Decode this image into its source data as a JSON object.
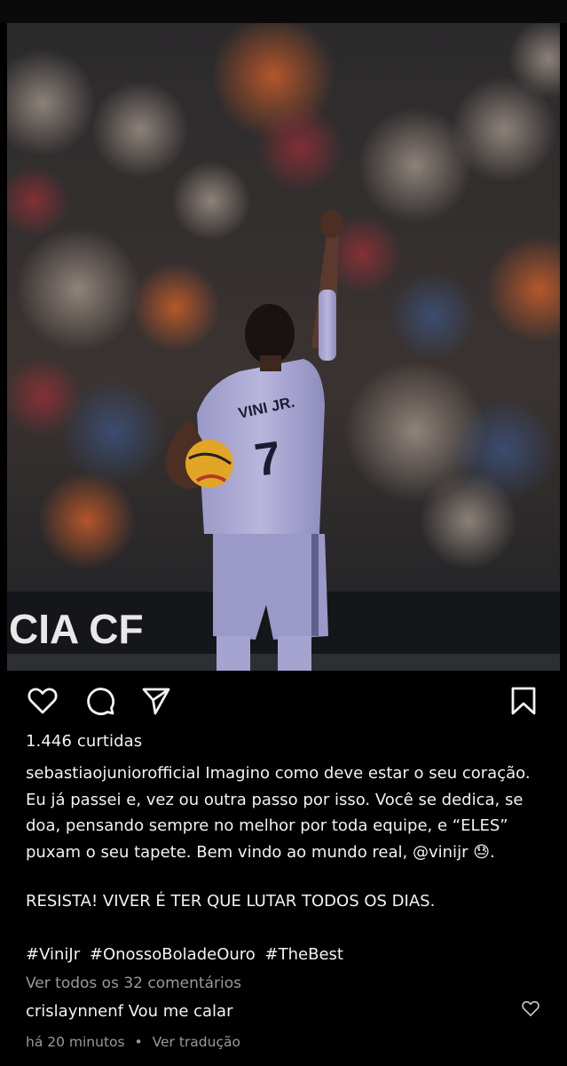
{
  "post": {
    "likes_text": "1.446 curtidas",
    "author": "sebastiaojuniorofficial",
    "caption_text": "Imagino como deve estar o seu coração. Eu já passei e, vez ou outra passo por isso. Você se dedica, se doa, pensando sempre no melhor por toda equipe, e “ELES” puxam o seu tapete. Bem vindo ao mundo real,",
    "mention": "@vinijr",
    "emoji": "😓",
    "caption_shout": "RESISTA! VIVER É TER QUE LUTAR TODOS OS DIAS.",
    "hashtags": [
      "#ViniJr",
      "#OnossoBoladeOuro",
      "#TheBest"
    ],
    "view_all_comments": "Ver todos os 32 comentários",
    "comment": {
      "user": "crislaynnenf",
      "text": "Vou me calar"
    },
    "time_ago": "há 20 minutos",
    "dot": "•",
    "translate_label": "Ver tradução"
  },
  "photo": {
    "jersey_name": "VINI JR.",
    "jersey_number": "7",
    "board_text": "CIA CF"
  },
  "icons": {
    "like": "heart-icon",
    "comment": "comment-icon",
    "share": "share-icon",
    "save": "bookmark-icon",
    "comment_like": "heart-icon"
  },
  "colors": {
    "background": "#000000",
    "text": "#f2f2f2",
    "muted": "#9a9a9a"
  }
}
